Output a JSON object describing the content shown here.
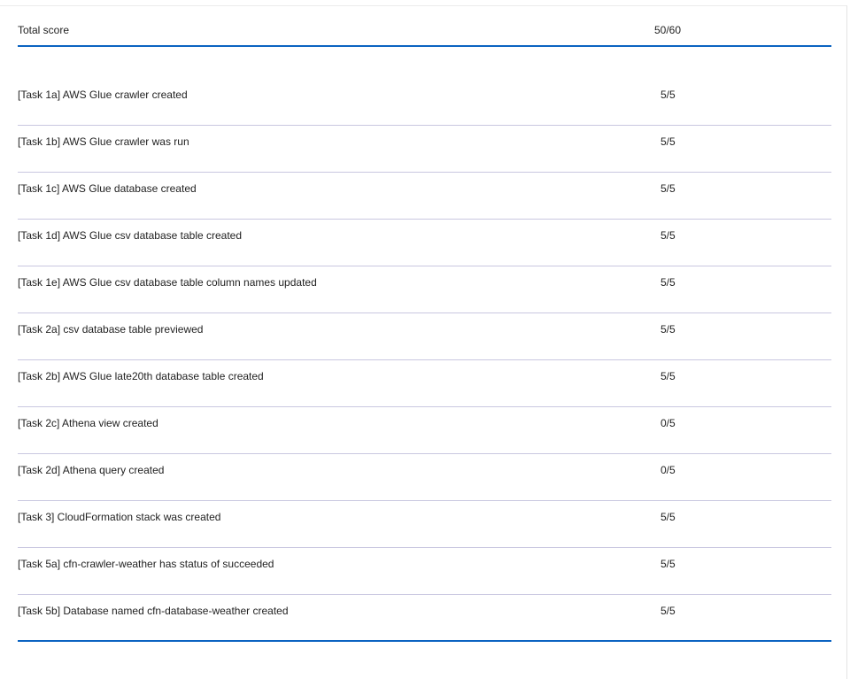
{
  "colors": {
    "accent": "#0b63c1",
    "separator": "#c9c7e0"
  },
  "header": {
    "label": "Total score",
    "score": "50/60"
  },
  "tasks": [
    {
      "label": "[Task 1a] AWS Glue crawler created",
      "score": "5/5"
    },
    {
      "label": "[Task 1b] AWS Glue crawler was run",
      "score": "5/5"
    },
    {
      "label": "[Task 1c] AWS Glue database created",
      "score": "5/5"
    },
    {
      "label": "[Task 1d] AWS Glue csv database table created",
      "score": "5/5"
    },
    {
      "label": "[Task 1e] AWS Glue csv database table column names updated",
      "score": "5/5"
    },
    {
      "label": "[Task 2a] csv database table previewed",
      "score": "5/5"
    },
    {
      "label": "[Task 2b] AWS Glue late20th database table created",
      "score": "5/5"
    },
    {
      "label": "[Task 2c] Athena view created",
      "score": "0/5"
    },
    {
      "label": "[Task 2d] Athena query created",
      "score": "0/5"
    },
    {
      "label": "[Task 3] CloudFormation stack was created",
      "score": "5/5"
    },
    {
      "label": "[Task 5a] cfn-crawler-weather has status of succeeded",
      "score": "5/5"
    },
    {
      "label": "[Task 5b] Database named cfn-database-weather created",
      "score": "5/5"
    }
  ]
}
